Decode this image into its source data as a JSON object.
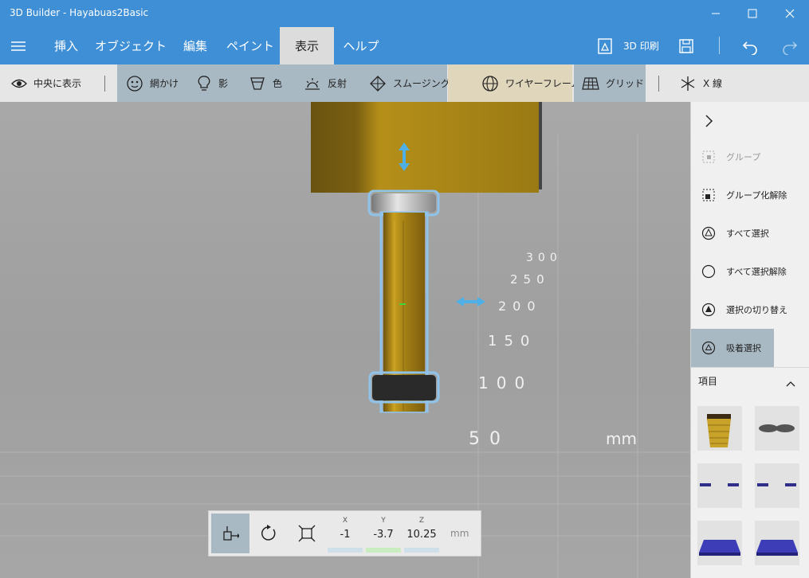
{
  "window": {
    "title": "3D Builder - Hayabuas2Basic"
  },
  "menu": {
    "tabs": [
      "挿入",
      "オブジェクト",
      "編集",
      "ペイント",
      "表示",
      "ヘルプ"
    ],
    "active_tab": "表示",
    "print_label": "3D 印刷"
  },
  "ribbon": {
    "center_label": "中央に表示",
    "shading_label": "網かけ",
    "shadow_label": "影",
    "color_label": "色",
    "reflection_label": "反射",
    "smoothing_label": "スムージング",
    "wireframe_label": "ワイヤーフレーム",
    "grid_label": "グリッド",
    "xray_label": "X 線"
  },
  "side_panel": {
    "group_label": "グループ",
    "ungroup_label": "グループ化解除",
    "select_all_label": "すべて選択",
    "deselect_all_label": "すべて選択解除",
    "invert_selection_label": "選択の切り替え",
    "snap_select_label": "吸着選択",
    "items_header": "項目"
  },
  "viewport": {
    "grid_labels": [
      "50",
      "100",
      "150",
      "200",
      "250",
      "300"
    ],
    "unit": "mm"
  },
  "coordinates": {
    "x_label": "X",
    "x_value": "-1",
    "y_label": "Y",
    "y_value": "-3.7",
    "z_label": "Z",
    "z_value": "10.25",
    "unit": "mm"
  },
  "colors": {
    "accent": "#3e8fd5",
    "selection": "#4fb0e8",
    "object_gold": "#b8921a"
  }
}
